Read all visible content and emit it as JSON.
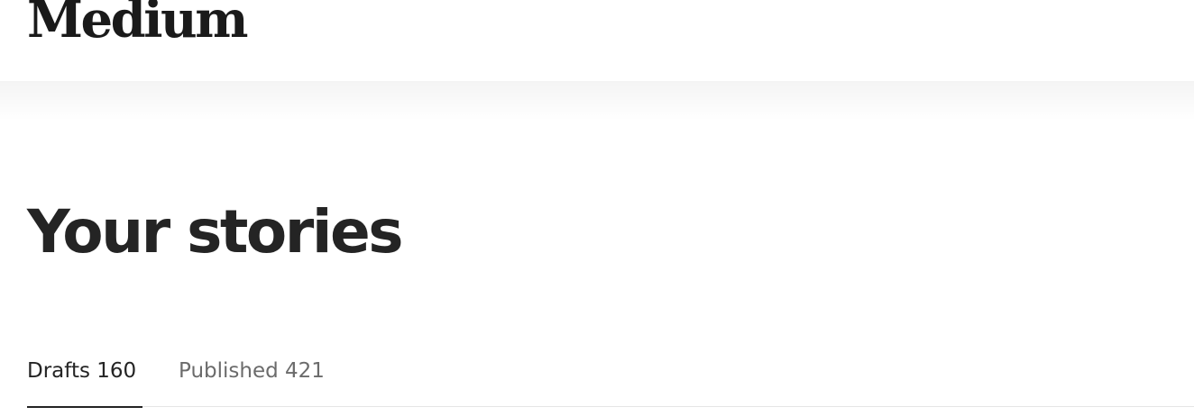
{
  "header": {
    "logo_text": "Medium"
  },
  "main": {
    "title": "Your stories",
    "tabs": [
      {
        "label": "Drafts 160",
        "active": true
      },
      {
        "label": "Published 421",
        "active": false
      }
    ]
  },
  "colors": {
    "text_primary": "#242424",
    "text_secondary": "#6b6b6b",
    "divider": "#e6e6e6",
    "background": "#ffffff"
  }
}
